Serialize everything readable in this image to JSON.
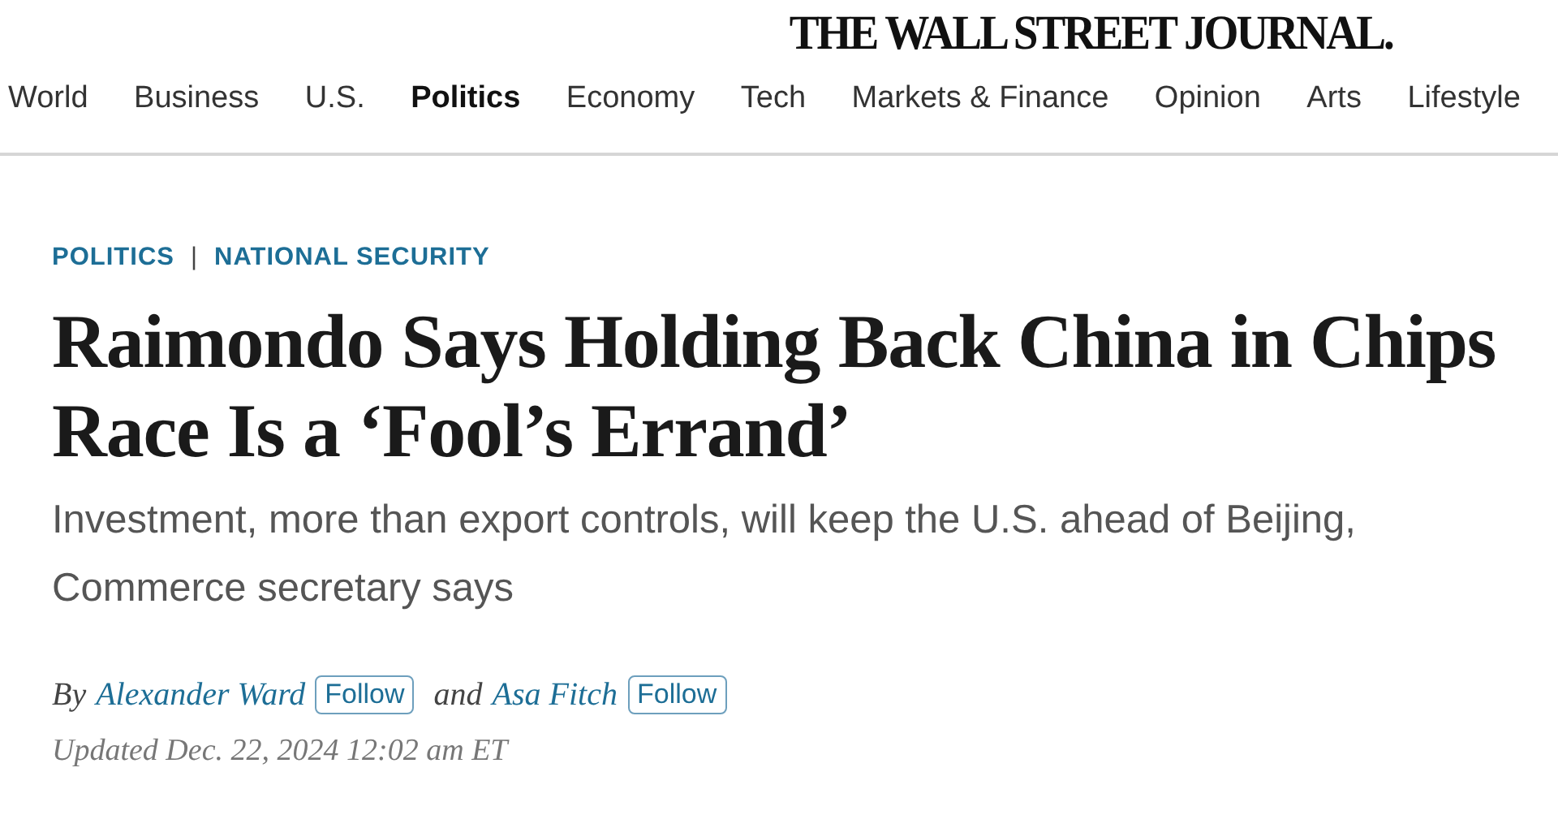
{
  "masthead": "THE WALL STREET JOURNAL.",
  "nav": [
    {
      "label": "World",
      "selected": false
    },
    {
      "label": "Business",
      "selected": false
    },
    {
      "label": "U.S.",
      "selected": false
    },
    {
      "label": "Politics",
      "selected": true
    },
    {
      "label": "Economy",
      "selected": false
    },
    {
      "label": "Tech",
      "selected": false
    },
    {
      "label": "Markets & Finance",
      "selected": false
    },
    {
      "label": "Opinion",
      "selected": false
    },
    {
      "label": "Arts",
      "selected": false
    },
    {
      "label": "Lifestyle",
      "selected": false
    }
  ],
  "breadcrumb": [
    "POLITICS",
    "NATIONAL SECURITY"
  ],
  "breadcrumb_separator": "|",
  "headline": "Raimondo Says Holding Back China in Chips Race Is a ‘Fool’s Errand’",
  "dek": "Investment, more than export controls, will keep the U.S. ahead of Beijing, Commerce secretary says",
  "byline": {
    "prefix": "By",
    "joiner": "and",
    "authors": [
      {
        "name": "Alexander Ward",
        "follow": "Follow"
      },
      {
        "name": "Asa Fitch",
        "follow": "Follow"
      }
    ]
  },
  "updated": "Updated Dec. 22, 2024 12:02 am ET"
}
